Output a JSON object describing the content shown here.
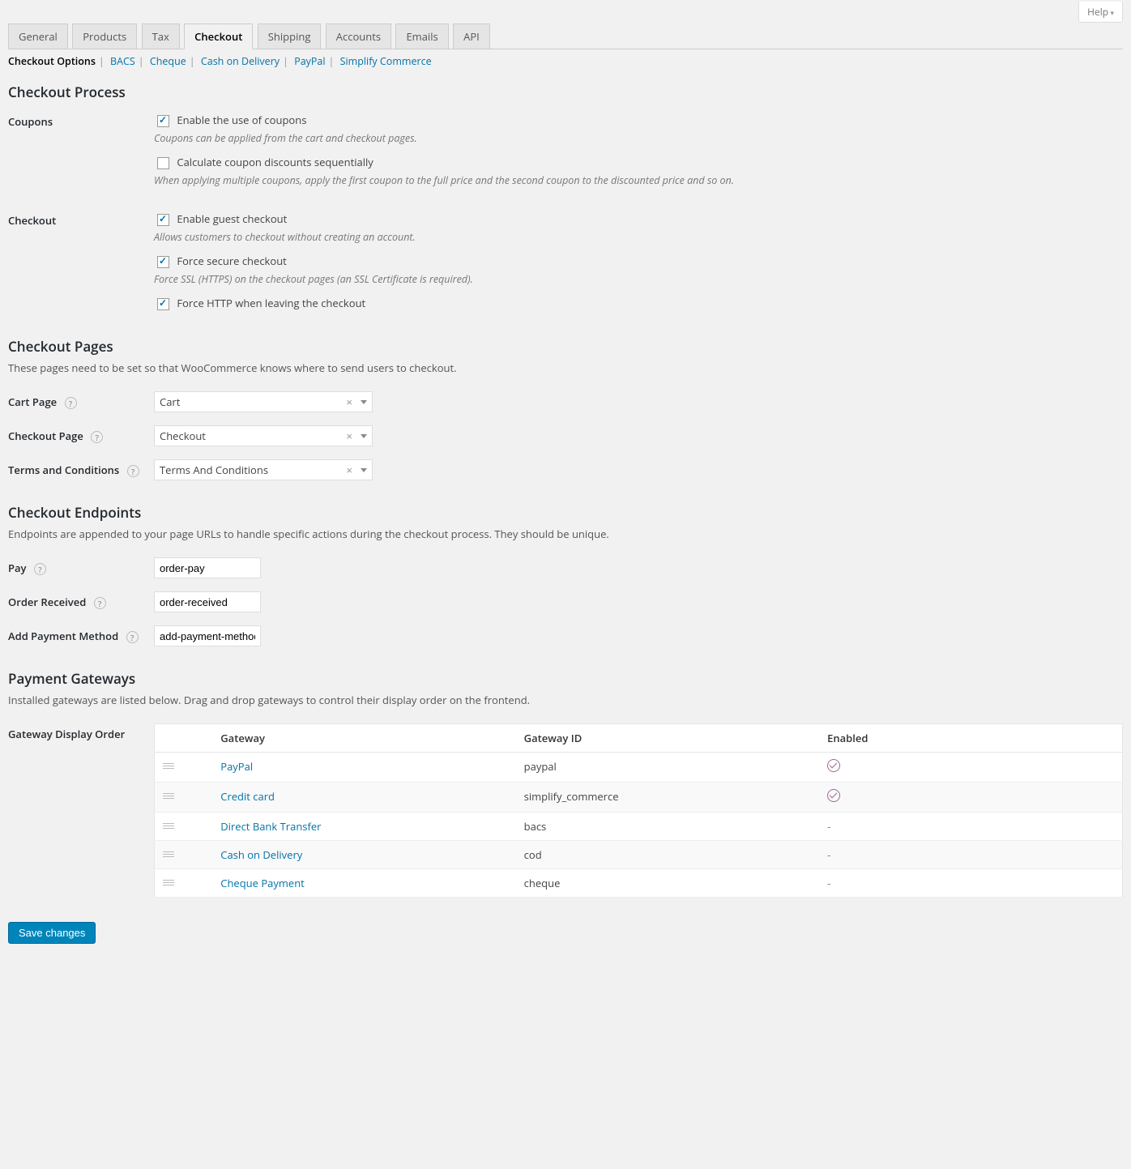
{
  "help_tab_label": "Help",
  "tabs": [
    "General",
    "Products",
    "Tax",
    "Checkout",
    "Shipping",
    "Accounts",
    "Emails",
    "API"
  ],
  "active_tab_index": 3,
  "subsections": [
    "Checkout Options",
    "BACS",
    "Cheque",
    "Cash on Delivery",
    "PayPal",
    "Simplify Commerce"
  ],
  "active_subsection_index": 0,
  "section_process_title": "Checkout Process",
  "coupons": {
    "row_label": "Coupons",
    "enable_label": "Enable the use of coupons",
    "enable_checked": true,
    "enable_desc": "Coupons can be applied from the cart and checkout pages.",
    "seq_label": "Calculate coupon discounts sequentially",
    "seq_checked": false,
    "seq_desc": "When applying multiple coupons, apply the first coupon to the full price and the second coupon to the discounted price and so on."
  },
  "checkout_opts": {
    "row_label": "Checkout",
    "guest_label": "Enable guest checkout",
    "guest_checked": true,
    "guest_desc": "Allows customers to checkout without creating an account.",
    "ssl_label": "Force secure checkout",
    "ssl_checked": true,
    "ssl_desc": "Force SSL (HTTPS) on the checkout pages (an SSL Certificate is required).",
    "unforce_label": "Force HTTP when leaving the checkout",
    "unforce_checked": true
  },
  "section_pages_title": "Checkout Pages",
  "section_pages_desc": "These pages need to be set so that WooCommerce knows where to send users to checkout.",
  "pages": {
    "cart_label": "Cart Page",
    "cart_value": "Cart",
    "checkout_label": "Checkout Page",
    "checkout_value": "Checkout",
    "terms_label": "Terms and Conditions",
    "terms_value": "Terms And Conditions"
  },
  "section_endpoints_title": "Checkout Endpoints",
  "section_endpoints_desc": "Endpoints are appended to your page URLs to handle specific actions during the checkout process. They should be unique.",
  "endpoints": {
    "pay_label": "Pay",
    "pay_value": "order-pay",
    "received_label": "Order Received",
    "received_value": "order-received",
    "add_pm_label": "Add Payment Method",
    "add_pm_value": "add-payment-method"
  },
  "section_gateways_title": "Payment Gateways",
  "section_gateways_desc": "Installed gateways are listed below. Drag and drop gateways to control their display order on the frontend.",
  "gateway_order_label": "Gateway Display Order",
  "gateway_table": {
    "col_gateway": "Gateway",
    "col_id": "Gateway ID",
    "col_enabled": "Enabled",
    "rows": [
      {
        "name": "PayPal",
        "id": "paypal",
        "enabled": true
      },
      {
        "name": "Credit card",
        "id": "simplify_commerce",
        "enabled": true
      },
      {
        "name": "Direct Bank Transfer",
        "id": "bacs",
        "enabled": false
      },
      {
        "name": "Cash on Delivery",
        "id": "cod",
        "enabled": false
      },
      {
        "name": "Cheque Payment",
        "id": "cheque",
        "enabled": false
      }
    ]
  },
  "save_button": "Save changes"
}
